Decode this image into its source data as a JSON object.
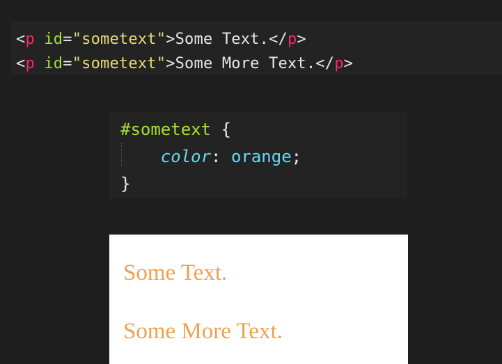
{
  "html_code": {
    "lines": [
      {
        "open_bracket": "<",
        "tag": "p",
        "attr_name": "id",
        "equals": "=",
        "attr_value": "\"sometext\"",
        "close_bracket": ">",
        "content": "Some Text.",
        "end_open": "</",
        "end_tag": "p",
        "end_close": ">"
      },
      {
        "open_bracket": "<",
        "tag": "p",
        "attr_name": "id",
        "equals": "=",
        "attr_value": "\"sometext\"",
        "close_bracket": ">",
        "content": "Some More Text.",
        "end_open": "</",
        "end_tag": "p",
        "end_close": ">"
      }
    ]
  },
  "css_code": {
    "selector": "#sometext",
    "open_brace": "{",
    "property": "color",
    "colon": ":",
    "value": "orange",
    "semicolon": ";",
    "close_brace": "}"
  },
  "preview": {
    "paragraphs": [
      "Some Text.",
      "Some More Text."
    ],
    "text_color": "#f0a050"
  },
  "colors": {
    "background": "#1e1e1e",
    "panel": "#232323",
    "tag": "#f92672",
    "attribute": "#a6e22e",
    "string": "#e6db74",
    "plain": "#e8e8e8",
    "selector": "#a6e22e",
    "property": "#66d9ef",
    "value": "#66d9ef"
  }
}
